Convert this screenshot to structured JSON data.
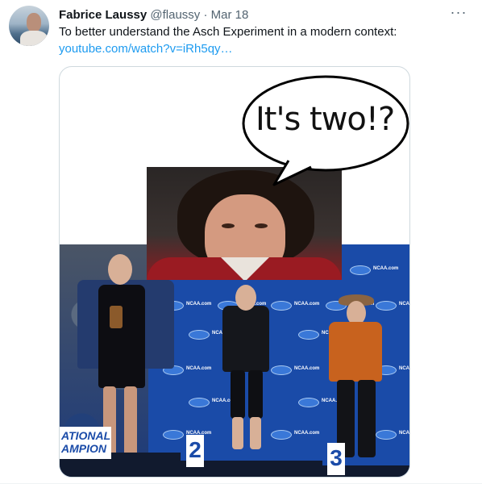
{
  "tweet": {
    "author_name": "Fabrice Laussy",
    "author_handle": "@flaussy",
    "separator": "·",
    "date": "Mar 18",
    "more_icon": "more-horizontal-icon",
    "more_glyph": "···",
    "text": "To better understand the Asch Experiment in a modern context:",
    "link": "youtube.com/watch?v=iRh5qy…"
  },
  "media": {
    "speech_bubble_text": "It's two!?",
    "banner_line1": "ATIONAL",
    "banner_line2": "AMPION",
    "podium_second": "2",
    "podium_third": "3",
    "logo_text": "NCAA.com"
  },
  "colors": {
    "link": "#1d9bf0",
    "secondary_text": "#536471",
    "stage_blue": "#1a4ba8"
  }
}
